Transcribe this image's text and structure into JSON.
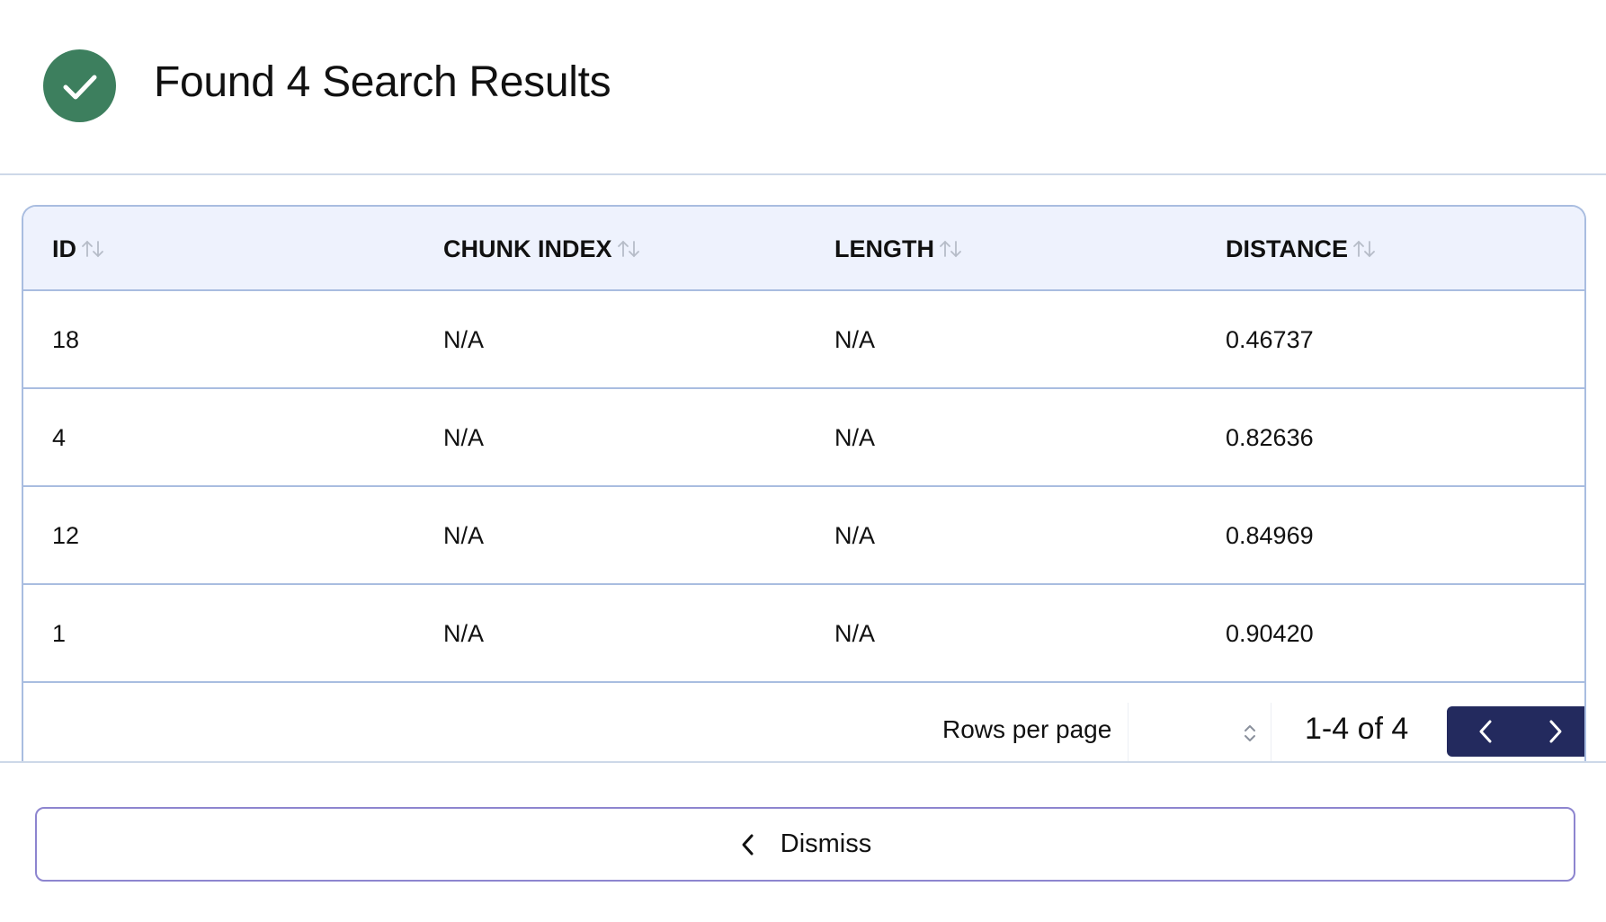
{
  "header": {
    "title": "Found 4 Search Results",
    "status_icon": "check-circle-icon",
    "status_color": "#3d7f5e"
  },
  "table": {
    "columns": [
      {
        "label": "ID",
        "sort_icon": "sort-arrows-icon"
      },
      {
        "label": "CHUNK INDEX",
        "sort_icon": "sort-arrows-icon"
      },
      {
        "label": "LENGTH",
        "sort_icon": "sort-arrows-icon"
      },
      {
        "label": "DISTANCE",
        "sort_icon": "sort-arrows-icon"
      }
    ],
    "rows": [
      {
        "id": "18",
        "chunk_index": "N/A",
        "length": "N/A",
        "distance": "0.46737"
      },
      {
        "id": "4",
        "chunk_index": "N/A",
        "length": "N/A",
        "distance": "0.82636"
      },
      {
        "id": "12",
        "chunk_index": "N/A",
        "length": "N/A",
        "distance": "0.84969"
      },
      {
        "id": "1",
        "chunk_index": "N/A",
        "length": "N/A",
        "distance": "0.90420"
      }
    ]
  },
  "pagination": {
    "rows_per_page_label": "Rows per page",
    "rows_per_page_value": "",
    "range_label": "1-4 of 4",
    "prev_icon": "chevron-left-icon",
    "next_icon": "chevron-right-icon",
    "button_color": "#232a5e"
  },
  "dismiss": {
    "label": "Dismiss",
    "icon": "chevron-left-icon"
  }
}
